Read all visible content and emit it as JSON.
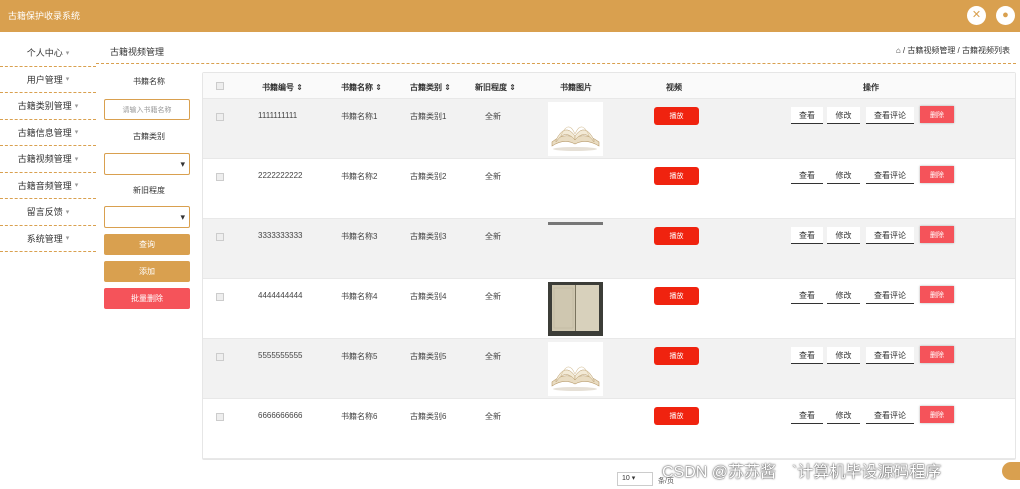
{
  "app": {
    "title": "古籍保护收录系统"
  },
  "sidebar": {
    "items": [
      {
        "label": "个人中心"
      },
      {
        "label": "用户管理"
      },
      {
        "label": "古籍类别管理"
      },
      {
        "label": "古籍信息管理"
      },
      {
        "label": "古籍视频管理"
      },
      {
        "label": "古籍音频管理"
      },
      {
        "label": "留言反馈"
      },
      {
        "label": "系统管理"
      }
    ],
    "chevron": "▾"
  },
  "header": {
    "page_title": "古籍视频管理",
    "breadcrumb": "⌂ / 古籍视频管理 / 古籍视频列表"
  },
  "filter": {
    "name_label": "书籍名称",
    "name_placeholder": "请输入书籍名称",
    "category_label": "古籍类别",
    "condition_label": "新旧程度",
    "search_label": "查询",
    "add_label": "添加",
    "batch_delete_label": "批量删除"
  },
  "table": {
    "headers": {
      "id": "书籍编号 ⇕",
      "name": "书籍名称 ⇕",
      "category": "古籍类别 ⇕",
      "condition": "新旧程度 ⇕",
      "image": "书籍图片",
      "video": "视频",
      "ops": "操作"
    },
    "actions": {
      "view": "查看",
      "edit": "修改",
      "review": "查看评论",
      "delete": "删除",
      "play": "播放"
    },
    "rows": [
      {
        "id": "1111111111",
        "name": "书籍名称1",
        "category": "古籍类别1",
        "condition": "全新",
        "image": "open-book"
      },
      {
        "id": "2222222222",
        "name": "书籍名称2",
        "category": "古籍类别2",
        "condition": "全新",
        "image": "none"
      },
      {
        "id": "3333333333",
        "name": "书籍名称3",
        "category": "古籍类别3",
        "condition": "全新",
        "image": "strip"
      },
      {
        "id": "4444444444",
        "name": "书籍名称4",
        "category": "古籍类别4",
        "condition": "全新",
        "image": "old-book"
      },
      {
        "id": "5555555555",
        "name": "书籍名称5",
        "category": "古籍类别5",
        "condition": "全新",
        "image": "open-book"
      },
      {
        "id": "6666666666",
        "name": "书籍名称6",
        "category": "古籍类别6",
        "condition": "全新",
        "image": "none"
      }
    ]
  },
  "pagination": {
    "page_size": "10",
    "label": "条/页"
  },
  "watermark": "CSDN @苏苏酱　`计算机毕设源码程序",
  "colors": {
    "accent": "#d9a04f",
    "danger": "#f5535a",
    "play": "#f0230f"
  }
}
